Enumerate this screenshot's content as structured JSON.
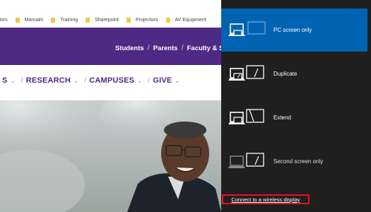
{
  "browser": {
    "bookmarks": [
      {
        "label": "dors"
      },
      {
        "label": "Manuals"
      },
      {
        "label": "Training"
      },
      {
        "label": "Sharepoint"
      },
      {
        "label": "Projectors"
      },
      {
        "label": "AV Equipment"
      }
    ],
    "header_links": [
      "Students",
      "Parents",
      "Faculty & Sta"
    ],
    "nav_items": [
      "S",
      "RESEARCH",
      "CAMPUSES",
      "GIVE"
    ],
    "colors": {
      "brand": "#4e2a84",
      "folder": "#f2c744"
    }
  },
  "project_panel": {
    "options": [
      {
        "label": "PC screen only",
        "icon": "pc-screen-only-icon",
        "selected": true
      },
      {
        "label": "Duplicate",
        "icon": "duplicate-icon",
        "selected": false
      },
      {
        "label": "Extend",
        "icon": "extend-icon",
        "selected": false
      },
      {
        "label": "Second screen only",
        "icon": "second-screen-only-icon",
        "selected": false
      }
    ],
    "connect_link": "Connect to a wireless display",
    "colors": {
      "background": "#1f1f1f",
      "selected": "#0063b1",
      "highlight_border": "#e81123"
    }
  }
}
